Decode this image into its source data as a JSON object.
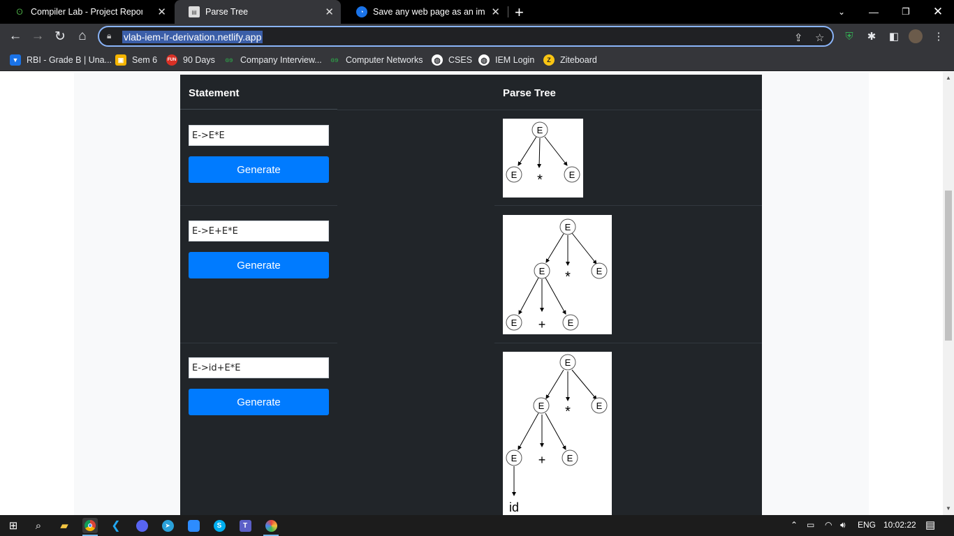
{
  "browser": {
    "tabs": [
      {
        "title": "Compiler Lab - Project Report - C",
        "icon": "overleaf-icon",
        "active": false
      },
      {
        "title": "Parse Tree",
        "icon": "page-icon",
        "active": true
      },
      {
        "title": "Save any web page as an image o",
        "icon": "web-capture-icon",
        "active": false
      }
    ],
    "url": "vlab-iem-lr-derivation.netlify.app",
    "bookmarks": [
      {
        "label": "RBI - Grade B | Una...",
        "icon": "rbi-icon",
        "color": "#1a73e8"
      },
      {
        "label": "Sem 6",
        "icon": "classroom-icon",
        "color": "#f4b400"
      },
      {
        "label": "90 Days",
        "icon": "fun-icon",
        "color": "#d93025"
      },
      {
        "label": "Company Interview...",
        "icon": "gfg-icon",
        "color": "#2f8d46"
      },
      {
        "label": "Computer Networks",
        "icon": "gfg-icon",
        "color": "#2f8d46"
      },
      {
        "label": "CSES",
        "icon": "globe-icon",
        "color": "#ffffff"
      },
      {
        "label": "IEM Login",
        "icon": "globe-icon",
        "color": "#ffffff"
      },
      {
        "label": "Ziteboard",
        "icon": "ziteboard-icon",
        "color": "#f9c513"
      }
    ]
  },
  "table": {
    "header_statement": "Statement",
    "header_tree": "Parse Tree",
    "rows": [
      {
        "input_value": "E->E*E",
        "button_label": "Generate"
      },
      {
        "input_value": "E->E+E*E",
        "button_label": "Generate"
      },
      {
        "input_value": "E->id+E*E",
        "button_label": "Generate"
      }
    ]
  },
  "trees": {
    "node_label": "E",
    "op_mul": "*",
    "op_add": "+",
    "leaf_id": "id"
  },
  "taskbar": {
    "lang": "ENG",
    "time": "10:02:22"
  },
  "colors": {
    "accent_button": "#007bff",
    "table_bg": "#212529",
    "omnibox_focus": "#8ab4f8"
  }
}
